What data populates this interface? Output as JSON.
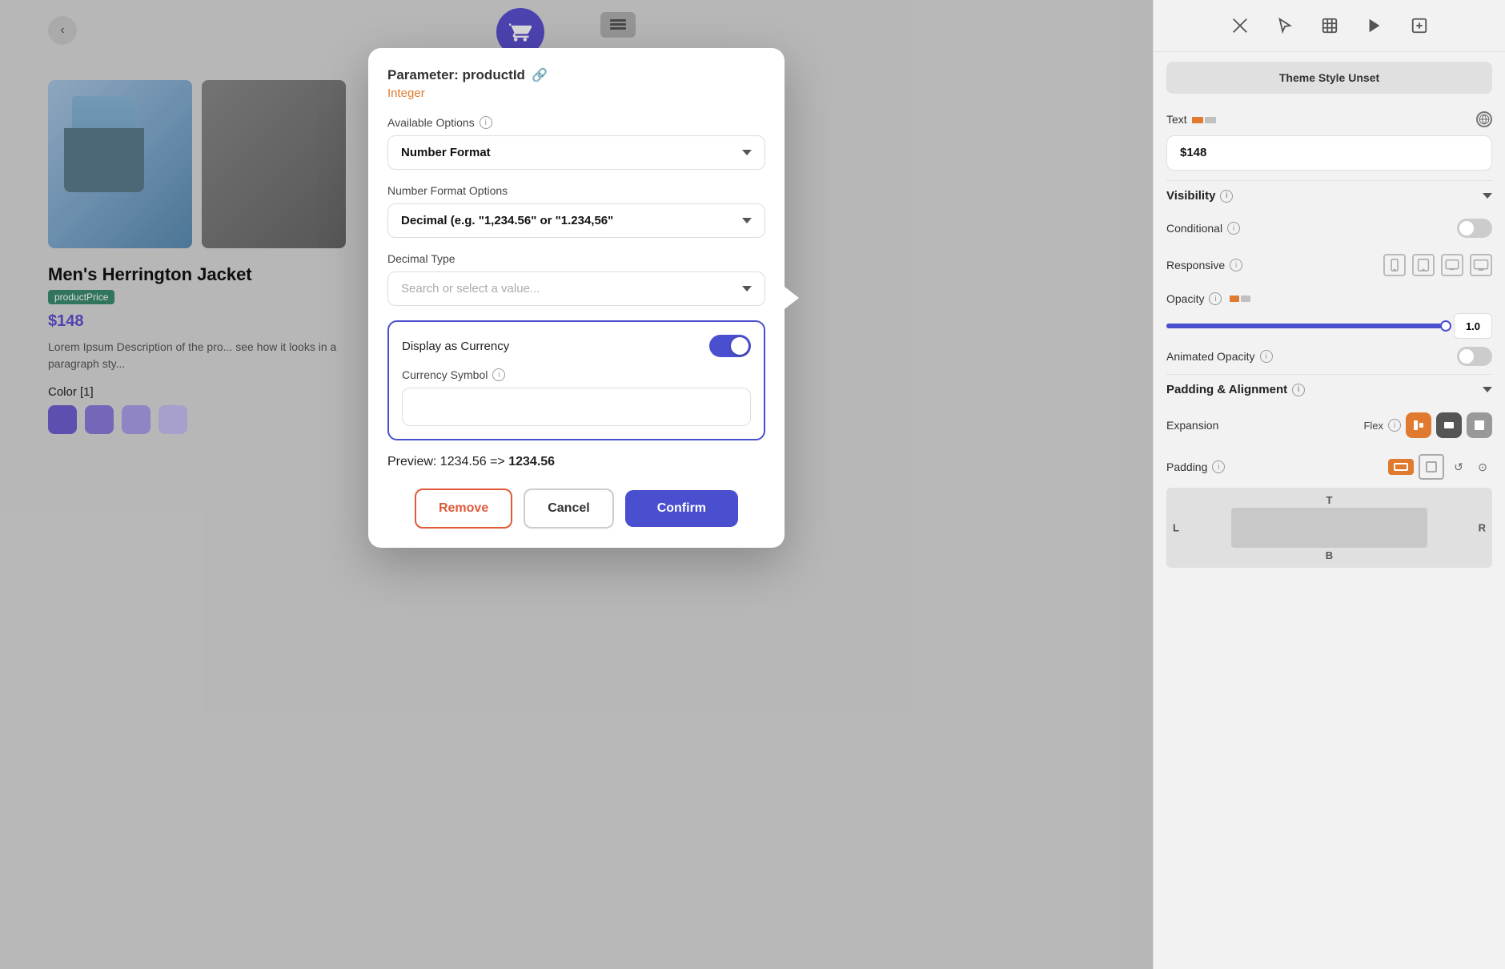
{
  "canvas": {
    "back_button": "‹",
    "product": {
      "title": "Men's Herrington Jacket",
      "tag": "productPrice",
      "price": "$148",
      "description": "Lorem Ipsum Description of the pro... see how it looks in a paragraph sty...",
      "color_label": "Color [1]",
      "swatches": [
        {
          "color": "#6b5fcf"
        },
        {
          "color": "#8a78d8"
        },
        {
          "color": "#a99de8"
        },
        {
          "color": "#c5bbf0"
        }
      ]
    }
  },
  "modal": {
    "title": "Parameter: productId",
    "subtitle": "Integer",
    "available_options_label": "Available Options",
    "available_options_value": "Number Format",
    "number_format_options_label": "Number Format Options",
    "number_format_options_value": "Decimal (e.g. \"1,234.56\" or \"1.234,56\"",
    "decimal_type_label": "Decimal Type",
    "decimal_type_placeholder": "Search or select a value...",
    "display_as_currency_label": "Display as Currency",
    "currency_symbol_label": "Currency Symbol",
    "currency_symbol_placeholder": "",
    "preview_label": "Preview: 1234.56 =>",
    "preview_value": "1234.56",
    "remove_btn": "Remove",
    "cancel_btn": "Cancel",
    "confirm_btn": "Confirm"
  },
  "right_panel": {
    "theme_style_btn": "Theme Style Unset",
    "text_label": "Text",
    "text_value": "$148",
    "visibility_label": "Visibility",
    "conditional_label": "Conditional",
    "responsive_label": "Responsive",
    "opacity_label": "Opacity",
    "opacity_value": "1.0",
    "animated_opacity_label": "Animated Opacity",
    "padding_alignment_label": "Padding & Alignment",
    "expansion_label": "Expansion",
    "flex_label": "Flex",
    "padding_label": "Padding",
    "padding_letters": {
      "top": "T",
      "bottom": "B",
      "left": "L",
      "right": "R"
    }
  }
}
